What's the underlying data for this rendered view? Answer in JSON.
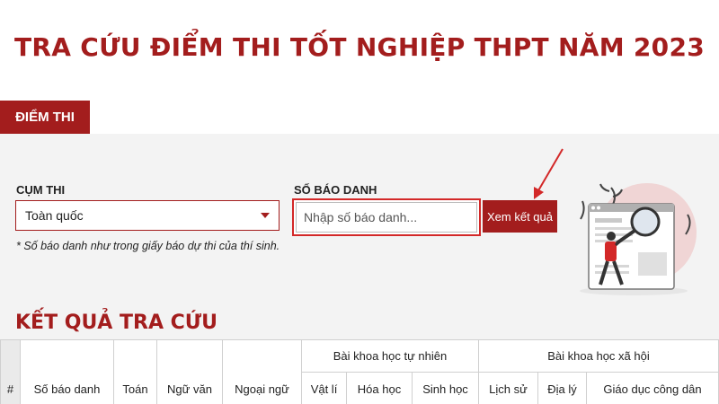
{
  "page": {
    "title": "TRA CỨU ĐIỂM THI TỐT NGHIỆP THPT NĂM 2023",
    "tab_label": "ĐIỂM THI"
  },
  "form": {
    "cum_thi_label": "CỤM THI",
    "cum_thi_value": "Toàn quốc",
    "so_bao_danh_label": "SỐ BÁO DANH",
    "so_bao_danh_placeholder": "Nhập số báo danh...",
    "submit_label": "Xem kết quả",
    "note": "* Số báo danh như trong giấy báo dự thi của thí sinh."
  },
  "results": {
    "title": "KẾT QUẢ TRA CỨU",
    "columns": {
      "index": "#",
      "sbd": "Số báo danh",
      "toan": "Toán",
      "ngu_van": "Ngữ văn",
      "ngoai_ngu": "Ngoại ngữ",
      "tu_nhien_group": "Bài khoa học tự nhiên",
      "vat_li": "Vật lí",
      "hoa_hoc": "Hóa học",
      "sinh_hoc": "Sinh học",
      "xa_hoi_group": "Bài khoa học xã hội",
      "lich_su": "Lịch sử",
      "dia_ly": "Địa lý",
      "gdcd": "Giáo dục công dân"
    }
  },
  "colors": {
    "brand": "#a31d1d",
    "highlight": "#d32828",
    "panel_bg": "#f3f3f3"
  },
  "icons": {
    "dropdown": "caret-down-icon",
    "annotation": "red-arrow-icon",
    "illustration": "magnifier-person-illustration"
  }
}
